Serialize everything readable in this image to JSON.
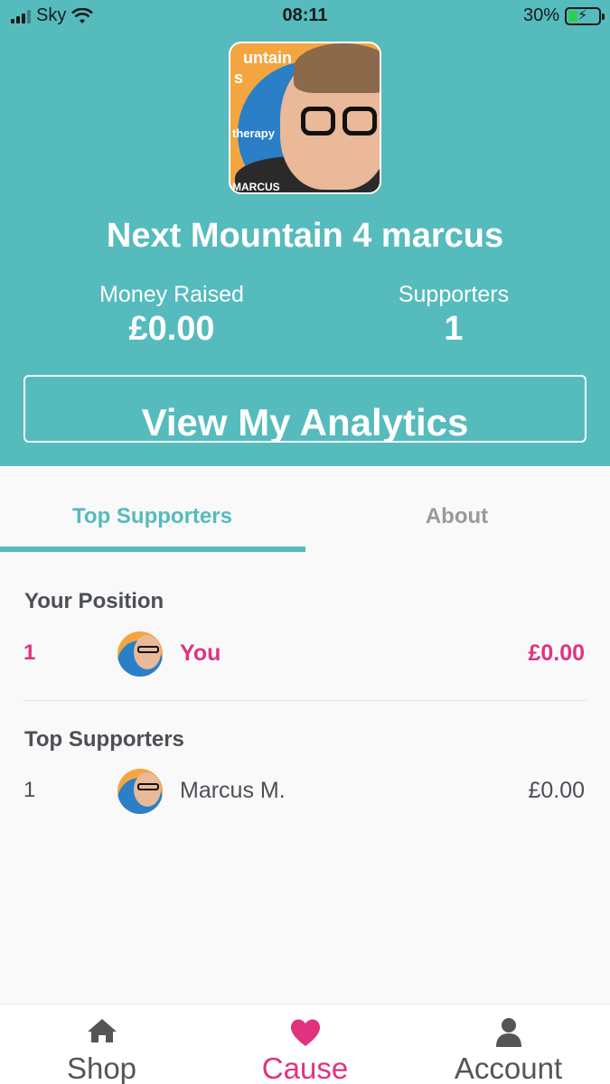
{
  "status_bar": {
    "carrier": "Sky",
    "time": "08:11",
    "battery": "30%",
    "battery_level": 0.3
  },
  "cause": {
    "title": "Next Mountain 4 marcus",
    "image_texts": [
      "untain",
      "s",
      "therapy",
      "MARCUS"
    ],
    "money_raised_label": "Money Raised",
    "money_raised_value": "£0.00",
    "supporters_label": "Supporters",
    "supporters_value": "1",
    "analytics_button": "View My Analytics"
  },
  "tabs": [
    {
      "label": "Top Supporters",
      "active": true
    },
    {
      "label": "About",
      "active": false
    }
  ],
  "your_position": {
    "title": "Your Position",
    "rank": "1",
    "name": "You",
    "amount": "£0.00"
  },
  "top_supporters": {
    "title": "Top Supporters",
    "rows": [
      {
        "rank": "1",
        "name": "Marcus  M.",
        "amount": "£0.00"
      }
    ]
  },
  "bottom_nav": [
    {
      "label": "Shop",
      "icon": "home-icon"
    },
    {
      "label": "Cause",
      "icon": "heart-icon",
      "active": true
    },
    {
      "label": "Account",
      "icon": "user-icon"
    }
  ],
  "colors": {
    "brand_teal": "#55bbbd",
    "accent_pink": "#e0337e"
  }
}
